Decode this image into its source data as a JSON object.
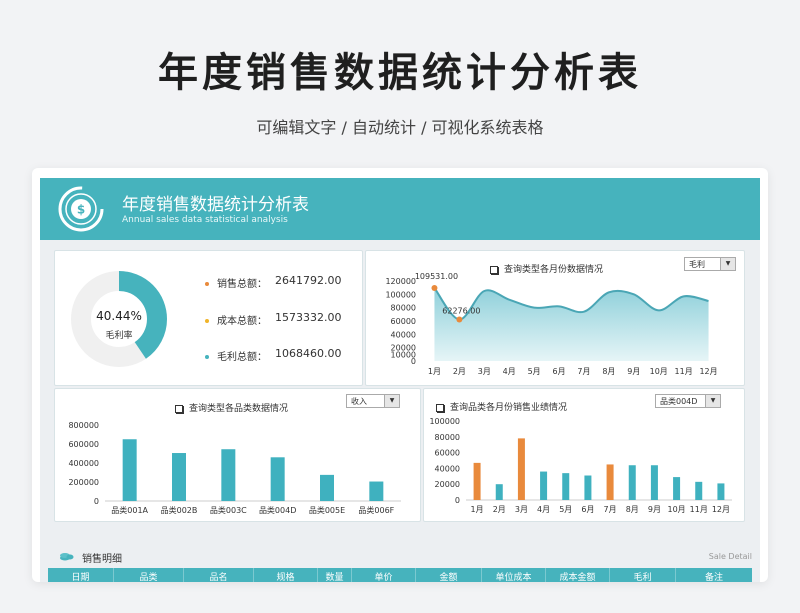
{
  "page": {
    "title": "年度销售数据统计分析表",
    "subtitle": "可编辑文字 / 自动统计 / 可视化系统表格"
  },
  "header": {
    "title": "年度销售数据统计分析表",
    "subtitle_en": "Annual sales data statistical analysis",
    "logo_icon": "dollar-coin-icon"
  },
  "kpi": {
    "donut_value": 0.4044,
    "donut_percent": "40.44%",
    "donut_label": "毛利率",
    "items": [
      {
        "label": "销售总额：",
        "value": "2641792.00",
        "color": "#e98a3c"
      },
      {
        "label": "成本总额：",
        "value": "1573332.00",
        "color": "#f0b429"
      },
      {
        "label": "毛利总额：",
        "value": "1068460.00",
        "color": "#46b3bd"
      }
    ]
  },
  "chart_data": [
    {
      "type": "area",
      "title": "查询类型各月份数据情况",
      "dropdown": "毛利",
      "categories": [
        "1月",
        "2月",
        "3月",
        "4月",
        "5月",
        "6月",
        "7月",
        "8月",
        "9月",
        "10月",
        "11月",
        "12月"
      ],
      "values": [
        109531,
        62276,
        105000,
        92000,
        80000,
        82000,
        74000,
        103000,
        100000,
        76000,
        97000,
        90000
      ],
      "yticks": [
        "0",
        "10000",
        "20000",
        "40000",
        "60000",
        "80000",
        "100000",
        "120000"
      ],
      "ylim": [
        0,
        120000
      ],
      "annotations": [
        "109531.00",
        "62276.00"
      ],
      "colors": {
        "line": "#4aa6b5",
        "fill": "#bfe4ea",
        "marker": "#e98a3c"
      }
    },
    {
      "type": "bar",
      "title": "查询类型各品类数据情况",
      "dropdown": "收入",
      "categories": [
        "品类001A",
        "品类002B",
        "品类003C",
        "品类004D",
        "品类005E",
        "品类006F"
      ],
      "values": [
        650000,
        505000,
        545000,
        460000,
        275000,
        205000
      ],
      "yticks": [
        "0",
        "200000",
        "400000",
        "600000",
        "800000"
      ],
      "ylim": [
        0,
        800000
      ],
      "colors": {
        "bar": "#3fb1bf"
      }
    },
    {
      "type": "bar",
      "title": "查询品类各月份销售业绩情况",
      "dropdown": "品类004D",
      "categories": [
        "1月",
        "2月",
        "3月",
        "4月",
        "5月",
        "6月",
        "7月",
        "8月",
        "9月",
        "10月",
        "11月",
        "12月"
      ],
      "values": [
        47000,
        20000,
        78000,
        36000,
        34000,
        31000,
        45000,
        44000,
        44000,
        29000,
        23000,
        21000
      ],
      "highlight": [
        true,
        false,
        true,
        false,
        false,
        false,
        true,
        false,
        false,
        false,
        false,
        false
      ],
      "yticks": [
        "0",
        "20000",
        "40000",
        "60000",
        "80000",
        "100000"
      ],
      "ylim": [
        0,
        100000
      ],
      "colors": {
        "bar": "#3fb1bf",
        "highlight": "#e98a3c"
      }
    }
  ],
  "detail": {
    "title": "销售明细",
    "subtitle_en": "Sale Detail",
    "icon": "stack-coins-icon",
    "columns": [
      "日期",
      "品类",
      "品名",
      "规格",
      "数量",
      "单价",
      "金额",
      "单位成本",
      "成本金额",
      "毛利",
      "备注"
    ]
  }
}
